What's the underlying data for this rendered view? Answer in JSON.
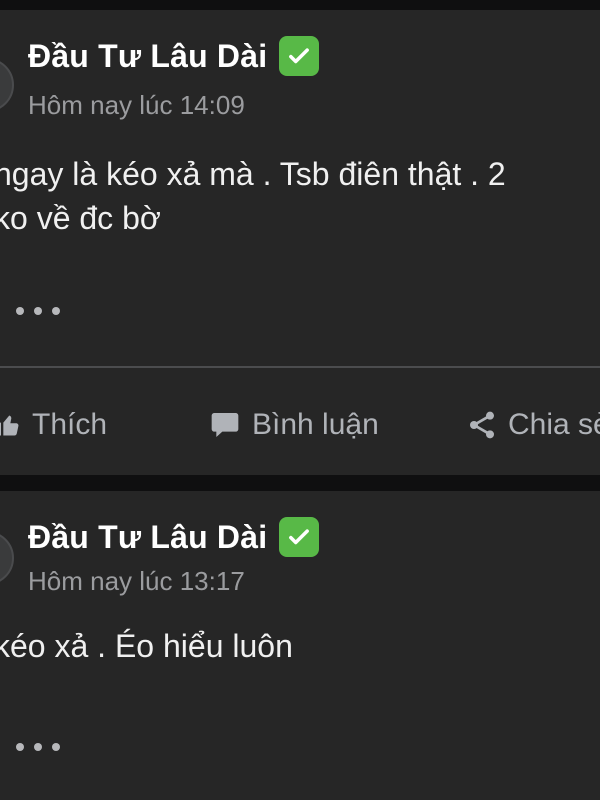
{
  "posts": [
    {
      "author": "Đầu Tư Lâu Dài",
      "time": "Hôm nay lúc 14:09",
      "content": "ngay là kéo xả mà . Tsb điên thật . 2\nko về đc bờ",
      "actions": {
        "like": "Thích",
        "comment": "Bình luận",
        "share": "Chia sẻ"
      }
    },
    {
      "author": "Đầu Tư Lâu Dài",
      "time": "Hôm nay lúc 13:17",
      "content": "kéo xả . Éo hiểu luôn"
    }
  ],
  "colors": {
    "background": "#0f0f10",
    "card": "#262626",
    "verified": "#58b947",
    "muted": "#9b9c9f"
  }
}
